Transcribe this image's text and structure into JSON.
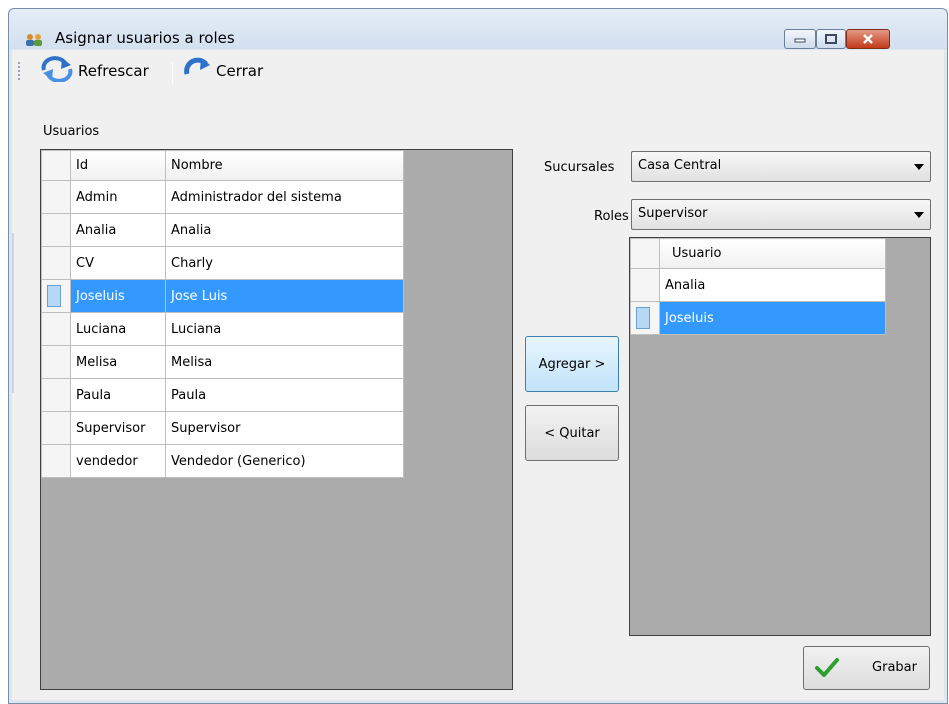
{
  "window": {
    "title": "Asignar usuarios a roles",
    "controls": {
      "minimize": "minimize",
      "maximize": "maximize",
      "close": "close"
    }
  },
  "toolbar": {
    "refresh_label": "Refrescar",
    "close_label": "Cerrar"
  },
  "users_panel": {
    "label": "Usuarios",
    "columns": [
      "Id",
      "Nombre"
    ],
    "rows": [
      {
        "id": "Admin",
        "nombre": "Administrador del sistema"
      },
      {
        "id": "Analia",
        "nombre": "Analia"
      },
      {
        "id": "CV",
        "nombre": "Charly"
      },
      {
        "id": "Joseluis",
        "nombre": "Jose Luis"
      },
      {
        "id": "Luciana",
        "nombre": "Luciana"
      },
      {
        "id": "Melisa",
        "nombre": "Melisa"
      },
      {
        "id": "Paula",
        "nombre": "Paula"
      },
      {
        "id": "Supervisor",
        "nombre": "Supervisor"
      },
      {
        "id": "vendedor",
        "nombre": "Vendedor (Generico)"
      }
    ],
    "selected_row": 3
  },
  "filters": {
    "sucursales_label": "Sucursales",
    "sucursales_value": "Casa Central",
    "roles_label": "Roles",
    "roles_value": "Supervisor"
  },
  "actions": {
    "agregar_label": "Agregar >",
    "quitar_label": "< Quitar"
  },
  "role_users": {
    "column": "Usuario",
    "rows": [
      "Analia",
      "Joseluis"
    ],
    "selected_row": 1
  },
  "footer": {
    "grabar_label": "Grabar"
  },
  "colors": {
    "selection": "#3399ff",
    "grid_background": "#ababab",
    "check": "#2e9e2e"
  }
}
